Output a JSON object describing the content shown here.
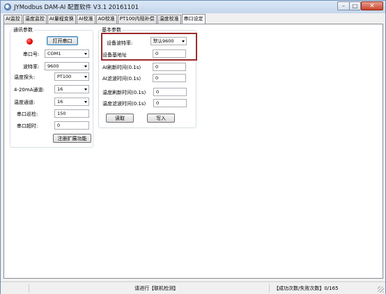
{
  "window": {
    "title": "JYModbus  DAM-AI 配置软件 V3.1   20161101",
    "min_glyph": "–",
    "max_glyph": "□",
    "close_glyph": "✕"
  },
  "tabs": [
    {
      "label": "AI监控"
    },
    {
      "label": "温度监控"
    },
    {
      "label": "AI量程变换"
    },
    {
      "label": "AI校准"
    },
    {
      "label": "AO校准"
    },
    {
      "label": "PT100内阻补偿"
    },
    {
      "label": "温度校准"
    },
    {
      "label": "串口设定"
    }
  ],
  "comm": {
    "legend": "通讯参数",
    "open_port_label": "打开串口",
    "port_label": "串口号:",
    "port_value": "COM1",
    "baud_label": "波特率:",
    "baud_value": "9600",
    "probe_label": "温度探头:",
    "probe_value": "PT100",
    "ai_channel_label": "4-20mA通道:",
    "ai_channel_value": "16",
    "temp_channel_label": "温度通道:",
    "temp_channel_value": "16",
    "poll_label": "串口巡检:",
    "poll_value": "150",
    "timeout_label": "串口超时:",
    "timeout_value": "0",
    "register_label": "注册扩展功能"
  },
  "basic": {
    "legend": "基本参数",
    "device_baud_label": "设备波特率:",
    "device_baud_value": "默认9600",
    "device_addr_label": "设备基地址",
    "device_addr_value": "0",
    "ai_refresh_label": "AI刷新时间(0.1s)",
    "ai_refresh_value": "0",
    "ai_filter_label": "AI滤波时间(0.1s)",
    "ai_filter_value": "0",
    "temp_refresh_label": "温度刷新时间(0.1s)",
    "temp_refresh_value": "0",
    "temp_filter_label": "温度滤波时间(0.1s)",
    "temp_filter_value": "0",
    "read_label": "读取",
    "write_label": "写入"
  },
  "status": {
    "hint": "请进行【联机检测】",
    "counts": "【成功次数/失败次数】0/165"
  },
  "colors": {
    "led": "#e00000",
    "highlight_border": "#9c2a2a",
    "title_gradient_top": "#dbe8f6"
  }
}
